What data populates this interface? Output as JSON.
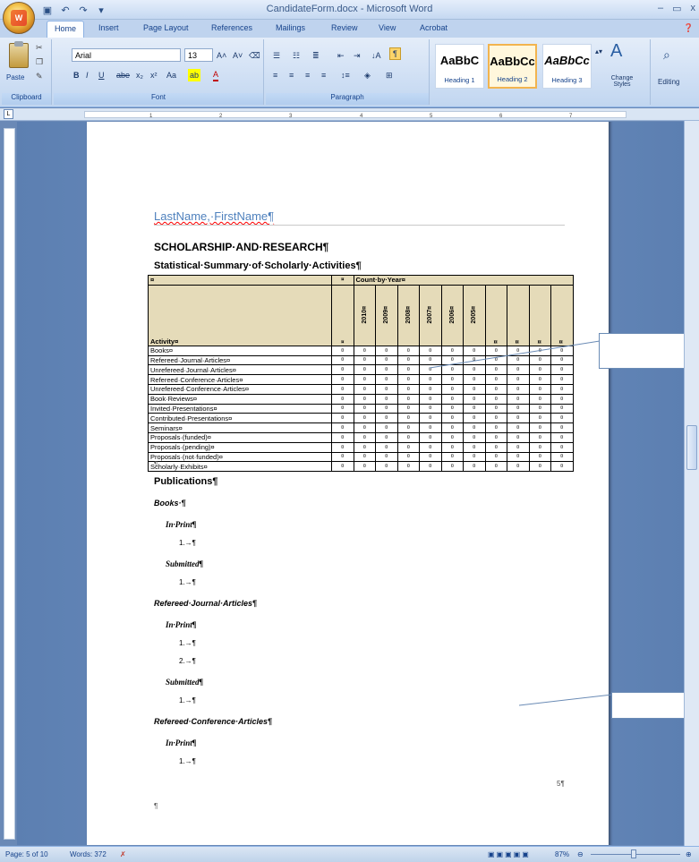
{
  "window": {
    "title": "CandidateForm.docx - Microsoft Word",
    "controls": {
      "minimize": "–",
      "restore": "▭",
      "close": "x"
    }
  },
  "qat": {
    "save_icon": "save-icon",
    "undo_icon": "undo-icon",
    "redo_icon": "redo-icon",
    "more_icon": "customize-icon"
  },
  "tabs": [
    "Home",
    "Insert",
    "Page Layout",
    "References",
    "Mailings",
    "Review",
    "View",
    "Acrobat"
  ],
  "ribbon": {
    "clipboard": {
      "paste": "Paste",
      "label": "Clipboard"
    },
    "font": {
      "name": "Arial",
      "size": "13",
      "label": "Font"
    },
    "paragraph": {
      "label": "Paragraph"
    },
    "styles": [
      {
        "sample": "AaBbC",
        "name": "Heading 1"
      },
      {
        "sample": "AaBbCc",
        "name": "Heading 2"
      },
      {
        "sample": "AaBbCc",
        "name": "Heading 3"
      }
    ],
    "change_styles": "Change Styles",
    "editing": "Editing"
  },
  "ruler": {
    "numbers": [
      "1",
      "2",
      "3",
      "4",
      "5",
      "6",
      "7"
    ]
  },
  "document": {
    "name_line": "LastName,·FirstName¶",
    "heading": "SCHOLARSHIP·AND·RESEARCH¶",
    "subheading": "Statistical·Summary·of·Scholarly·Activities¶",
    "table": {
      "header_cell": "¤",
      "count_by_year": "Count·by·Year¤",
      "activity_header": "Activity¤",
      "years": [
        "2010¤",
        "2009¤",
        "2008¤",
        "2007¤",
        "2006¤",
        "2005¤",
        "¤",
        "¤",
        "¤",
        "¤"
      ],
      "rows": [
        "Books¤",
        "Refereed·Journal·Articles¤",
        "Unrefereed·Journal·Articles¤",
        "Refereed·Conference·Articles¤",
        "Unrefereed·Conference·Articles¤",
        "Book·Reviews¤",
        "Invited·Presentations¤",
        "Contributed·Presentations¤",
        "Seminars¤",
        "Proposals·(funded)¤",
        "Proposals·(pending)¤",
        "Proposals·(not·funded)¤",
        "Scholarly·Exhibits¤"
      ],
      "cell": "¤"
    },
    "after_table": "¶",
    "publications": "Publications¶",
    "sections": [
      {
        "title": "Books·¶",
        "subs": [
          {
            "title": "In·Print¶",
            "items": [
              "1.→¶"
            ]
          },
          {
            "title": "Submitted¶",
            "items": [
              "1.→¶"
            ]
          }
        ]
      },
      {
        "title": "Refereed·Journal·Articles¶",
        "subs": [
          {
            "title": "In·Print¶",
            "items": [
              "1.→¶",
              "2.→¶"
            ]
          },
          {
            "title": "Submitted¶",
            "items": [
              "1.→¶"
            ]
          }
        ]
      },
      {
        "title": "Refereed·Conference·Articles¶",
        "subs": [
          {
            "title": "In·Print¶",
            "items": [
              "1.→¶"
            ]
          }
        ]
      }
    ],
    "page_number": "5¶",
    "footer_mark": "¶"
  },
  "status": {
    "page": "Page: 5 of 10",
    "words": "Words: 372",
    "zoom": "87%"
  }
}
